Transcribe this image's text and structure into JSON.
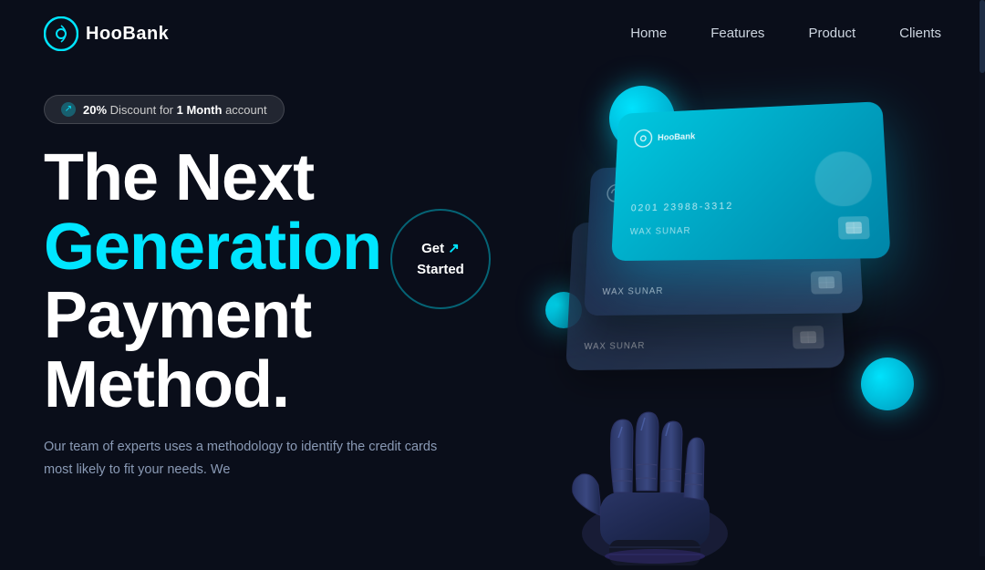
{
  "brand": {
    "name": "HooBank",
    "logo_alt": "HooBank logo"
  },
  "nav": {
    "links": [
      {
        "label": "Home",
        "id": "nav-home"
      },
      {
        "label": "Features",
        "id": "nav-features"
      },
      {
        "label": "Product",
        "id": "nav-product"
      },
      {
        "label": "Clients",
        "id": "nav-clients"
      }
    ]
  },
  "hero": {
    "badge": {
      "percent": "20%",
      "text1": " Discount for ",
      "bold": "1 Month",
      "text2": " account"
    },
    "heading_line1": "The Next",
    "heading_line2": "Generation",
    "heading_line3": "Payment",
    "heading_line4": "Method.",
    "cta_label": "Get",
    "cta_arrow": "↗",
    "cta_label2": "Started",
    "description": "Our team of experts uses a methodology to identify the credit cards most likely to fit your needs. We"
  },
  "cards": [
    {
      "number": "0201 23988-3312",
      "holder": "WAX SUNAR",
      "id": "card-1"
    },
    {
      "number": "•••• •••• •••• ••••",
      "holder": "WAX SUNAR",
      "id": "card-2"
    },
    {
      "number": "•••• •••• •••• ••••",
      "holder": "WAX SUNAR",
      "id": "card-3"
    }
  ],
  "colors": {
    "accent": "#00e5ff",
    "bg": "#0a0e1a",
    "card_cyan": "#00c8e0",
    "card_dark": "#1a2a4a"
  }
}
